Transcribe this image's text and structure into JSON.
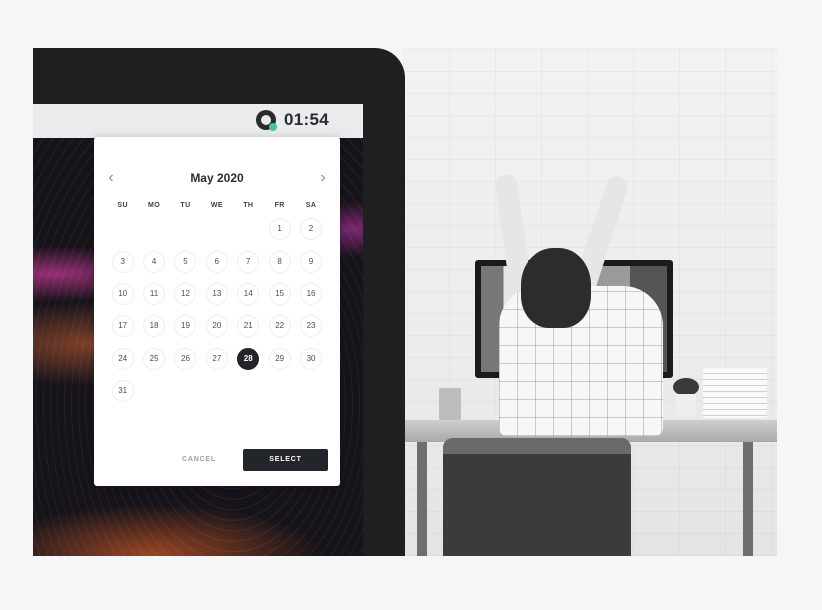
{
  "timer": {
    "time": "01:54",
    "icon": "timer-icon",
    "accent": "#49c1a2"
  },
  "calendar": {
    "month_title": "May 2020",
    "prev_icon": "chevron-left-icon",
    "next_icon": "chevron-right-icon",
    "weekdays": [
      "SU",
      "MO",
      "TU",
      "WE",
      "TH",
      "FR",
      "SA"
    ],
    "weeks": [
      [
        "",
        "",
        "",
        "",
        "",
        "1",
        "2"
      ],
      [
        "3",
        "4",
        "5",
        "6",
        "7",
        "8",
        "9"
      ],
      [
        "10",
        "11",
        "12",
        "13",
        "14",
        "15",
        "16"
      ],
      [
        "17",
        "18",
        "19",
        "20",
        "21",
        "22",
        "23"
      ],
      [
        "24",
        "25",
        "26",
        "27",
        "28",
        "29",
        "30"
      ],
      [
        "31",
        "",
        "",
        "",
        "",
        "",
        ""
      ]
    ],
    "selected_day": "28",
    "selected_color": "#22252a"
  },
  "actions": {
    "cancel_label": "CANCEL",
    "select_label": "SELECT"
  }
}
